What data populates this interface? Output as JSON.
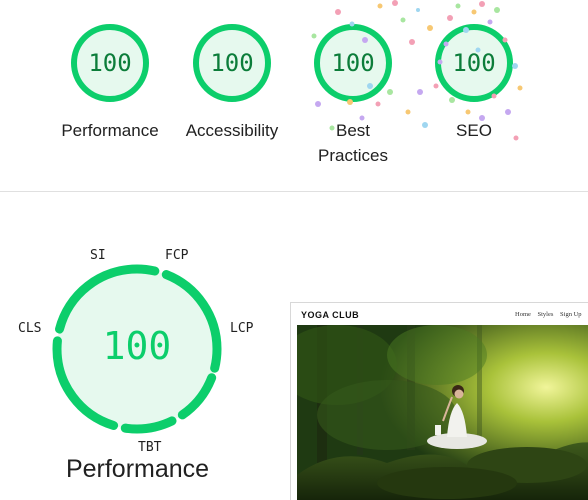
{
  "summary_scores": [
    {
      "score": "100",
      "label": "Performance"
    },
    {
      "score": "100",
      "label": "Accessibility"
    },
    {
      "score": "100",
      "label": "Best Practices"
    },
    {
      "score": "100",
      "label": "SEO"
    }
  ],
  "performance_detail": {
    "score": "100",
    "title": "Performance",
    "metrics": {
      "si": "SI",
      "fcp": "FCP",
      "lcp": "LCP",
      "tbt": "TBT",
      "cls": "CLS"
    }
  },
  "preview": {
    "brand": "YOGA CLUB",
    "nav": [
      "Home",
      "Styles",
      "Sign Up"
    ]
  },
  "colors": {
    "pass_green": "#0cce6b",
    "pass_fill": "#e6f9ee",
    "pass_text": "#0c7d3a",
    "text": "#212121"
  },
  "icons": {
    "confetti": "celebration-confetti-icon"
  }
}
